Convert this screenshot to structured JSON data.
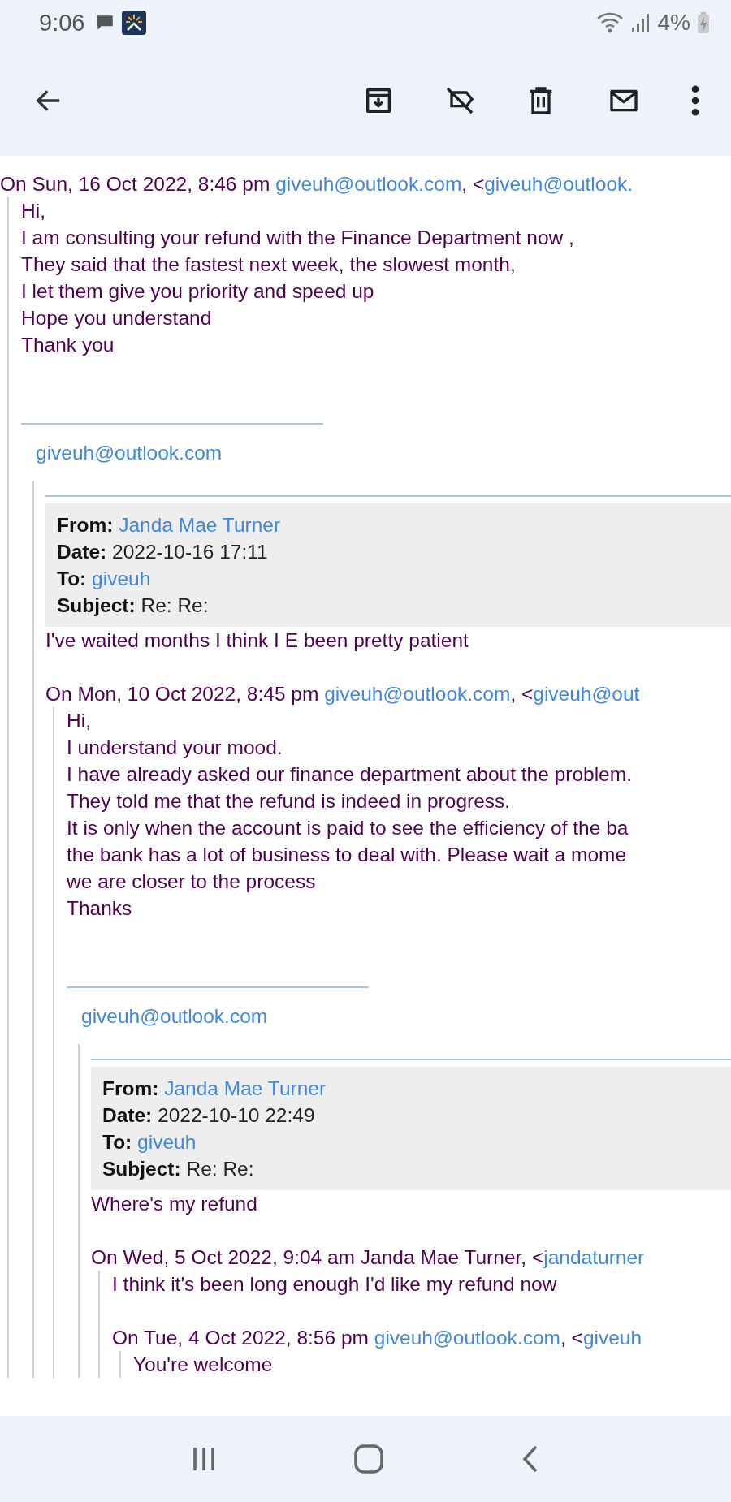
{
  "status_bar": {
    "time": "9:06",
    "battery": "4%"
  },
  "thread": {
    "header": [
      {
        "kind": "text",
        "text": "On Sun, 16 Oct 2022, 8:46 pm "
      },
      {
        "kind": "link",
        "text": "giveuh@outlook.com"
      },
      {
        "kind": "text",
        "text": ", <"
      },
      {
        "kind": "link",
        "text": "giveuh@outlook."
      }
    ],
    "body": [
      "Hi,",
      "I am  consulting your refund with the Finance Department now ,",
      "They said that the fastest next week, the slowest month,",
      "I let them give you priority and speed up",
      "Hope you understand",
      "Thank you"
    ],
    "signature": "giveuh@outlook.com",
    "forward": {
      "fields": [
        {
          "label": "From:",
          "value": "Janda Mae Turner",
          "kind": "link"
        },
        {
          "label": "Date:",
          "value": "2022-10-16 17:11",
          "kind": "text"
        },
        {
          "label": "To:",
          "value": "giveuh",
          "kind": "link"
        },
        {
          "label": "Subject:",
          "value": "Re: Re:",
          "kind": "text"
        }
      ],
      "body": [
        "I've waited months I think I E been pretty patient"
      ],
      "quoted": {
        "header": [
          {
            "kind": "text",
            "text": "On Mon, 10 Oct 2022, 8:45 pm "
          },
          {
            "kind": "link",
            "text": "giveuh@outlook.com"
          },
          {
            "kind": "text",
            "text": ", <"
          },
          {
            "kind": "link",
            "text": "giveuh@out"
          }
        ],
        "body": [
          "Hi,",
          "I understand your mood.",
          "I have already asked our finance department about the problem.",
          "They told me that the refund is indeed in progress.",
          " It is only when the account is paid to see the efficiency of the ba",
          "the bank has a lot of business to deal with. Please wait a mome",
          "we are closer to the process",
          "Thanks"
        ],
        "signature": "giveuh@outlook.com",
        "forward": {
          "fields": [
            {
              "label": "From:",
              "value": "Janda Mae Turner",
              "kind": "link"
            },
            {
              "label": "Date:",
              "value": "2022-10-10 22:49",
              "kind": "text"
            },
            {
              "label": "To:",
              "value": "giveuh",
              "kind": "link"
            },
            {
              "label": "Subject:",
              "value": "Re: Re:",
              "kind": "text"
            }
          ],
          "body": [
            "Where's my refund"
          ],
          "quoted": {
            "header": [
              {
                "kind": "text",
                "text": "On Wed, 5 Oct 2022, 9:04 am Janda Mae Turner, <"
              },
              {
                "kind": "link",
                "text": "jandaturner"
              }
            ],
            "body": [
              "I think it's been long enough I'd like my refund now"
            ],
            "quoted": {
              "header": [
                {
                  "kind": "text",
                  "text": "On Tue, 4 Oct 2022, 8:56 pm "
                },
                {
                  "kind": "link",
                  "text": "giveuh@outlook.com"
                },
                {
                  "kind": "text",
                  "text": ", <"
                },
                {
                  "kind": "link",
                  "text": "giveuh"
                }
              ],
              "body": [
                "You're welcome"
              ]
            }
          }
        }
      }
    }
  }
}
